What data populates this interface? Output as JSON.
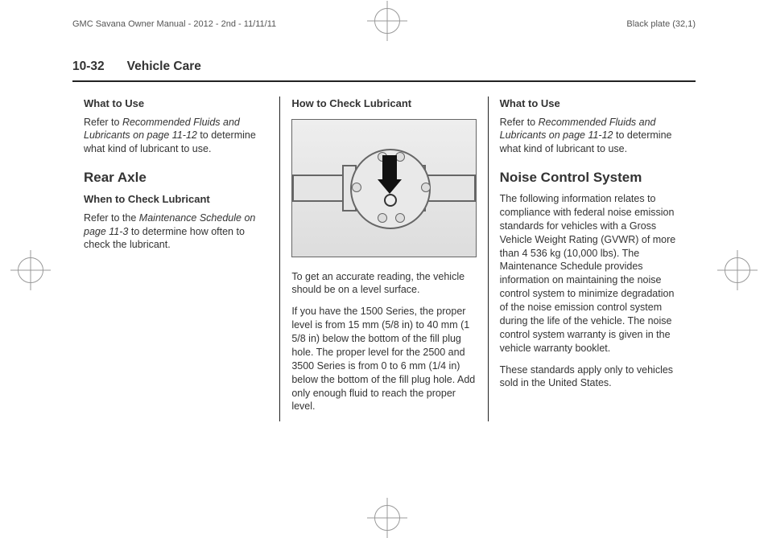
{
  "meta": {
    "manual_title": "GMC Savana Owner Manual - 2012 - 2nd - 11/11/11",
    "plate": "Black plate (32,1)"
  },
  "header": {
    "page_num": "10-32",
    "section": "Vehicle Care"
  },
  "col1": {
    "h1": "What to Use",
    "p1a": "Refer to ",
    "p1i": "Recommended Fluids and Lubricants on page 11-12",
    "p1b": " to determine what kind of lubricant to use.",
    "h2": "Rear Axle",
    "h3": "When to Check Lubricant",
    "p2a": "Refer to the ",
    "p2i": "Maintenance Schedule on page 11-3",
    "p2b": " to determine how often to check the lubricant."
  },
  "col2": {
    "h1": "How to Check Lubricant",
    "p1": "To get an accurate reading, the vehicle should be on a level surface.",
    "p2": "If you have the 1500 Series, the proper level is from 15 mm (5/8 in) to 40 mm (1 5/8 in) below the bottom of the fill plug hole. The proper level for the 2500 and 3500 Series is from 0 to 6 mm (1/4 in) below the bottom of the fill plug hole. Add only enough fluid to reach the proper level."
  },
  "col3": {
    "h1": "What to Use",
    "p1a": "Refer to ",
    "p1i": "Recommended Fluids and Lubricants on page 11-12",
    "p1b": " to determine what kind of lubricant to use.",
    "h2": "Noise Control System",
    "p2": "The following information relates to compliance with federal noise emission standards for vehicles with a Gross Vehicle Weight Rating (GVWR) of more than 4 536 kg (10,000 lbs). The Maintenance Schedule provides information on maintaining the noise control system to minimize degradation of the noise emission control system during the life of the vehicle. The noise control system warranty is given in the vehicle warranty booklet.",
    "p3": "These standards apply only to vehicles sold in the United States."
  }
}
